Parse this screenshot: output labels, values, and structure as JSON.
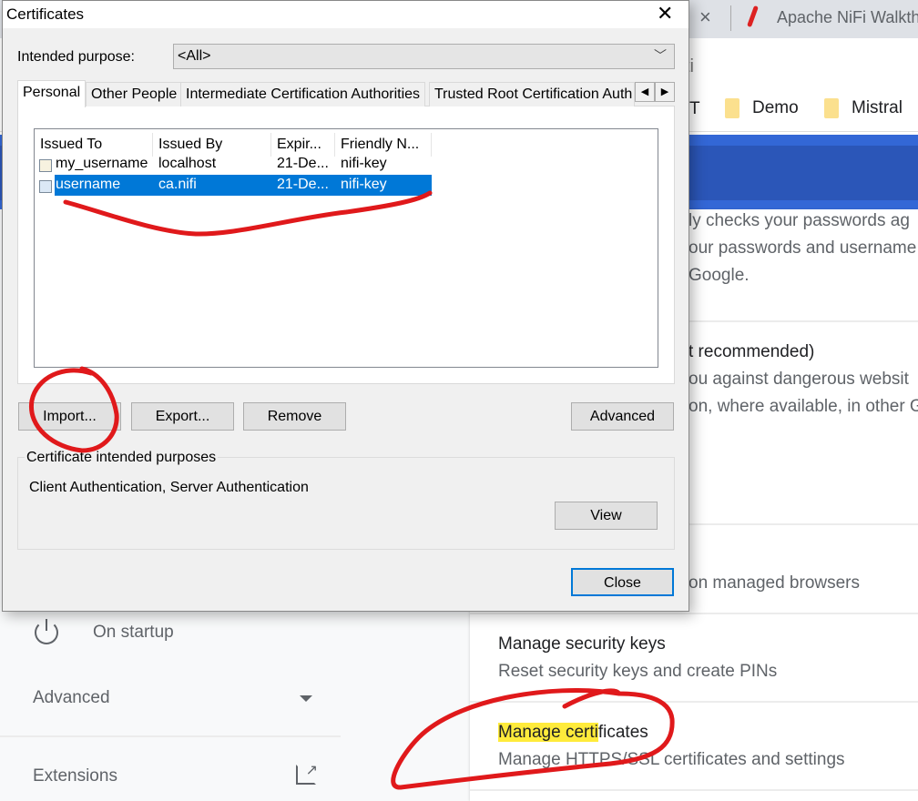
{
  "browser": {
    "tab_title": "Apache NiFi Walkth",
    "tab_close": "×",
    "address_fragment": "ti",
    "bookmarks": [
      {
        "label": "T"
      },
      {
        "label": "Demo"
      },
      {
        "label": "Mistral"
      }
    ]
  },
  "settings": {
    "content_lines": [
      "ly checks your passwords ag",
      "our passwords and username",
      "Google.",
      "t recommended)",
      "ou against dangerous websit",
      "on, where available, in other G",
      "on managed browsers"
    ],
    "security_keys": {
      "title": "Manage security keys",
      "subtitle": "Reset security keys and create PINs"
    },
    "certificates": {
      "title_highlight": "Manage certi",
      "title_rest": "ficates",
      "subtitle": "Manage HTTPS/SSL certificates and settings",
      "highlight_color": "#ffeb3b"
    },
    "sidebar": {
      "on_startup": "On startup",
      "advanced": "Advanced",
      "extensions": "Extensions"
    }
  },
  "dialog": {
    "title": "Certificates",
    "close_glyph": "✕",
    "intended_purpose_label": "Intended purpose:",
    "intended_purpose_value": "<All>",
    "tabs": [
      {
        "label": "Personal",
        "active": true
      },
      {
        "label": "Other People"
      },
      {
        "label": "Intermediate Certification Authorities"
      },
      {
        "label": "Trusted Root Certification Auth"
      }
    ],
    "columns": [
      "Issued To",
      "Issued By",
      "Expir...",
      "Friendly N..."
    ],
    "rows": [
      {
        "issued_to": "my_username",
        "issued_by": "localhost",
        "expiration": "21-De...",
        "friendly_name": "nifi-key",
        "selected": false
      },
      {
        "issued_to": "username",
        "issued_by": "ca.nifi",
        "expiration": "21-De...",
        "friendly_name": "nifi-key",
        "selected": true
      }
    ],
    "buttons": {
      "import": "Import...",
      "export": "Export...",
      "remove": "Remove",
      "advanced": "Advanced",
      "view": "View",
      "close": "Close"
    },
    "purposes_group_label": "Certificate intended purposes",
    "purposes_value": "Client Authentication, Server Authentication",
    "selection_color": "#0078d7"
  },
  "annotation_color": "#e0191b"
}
